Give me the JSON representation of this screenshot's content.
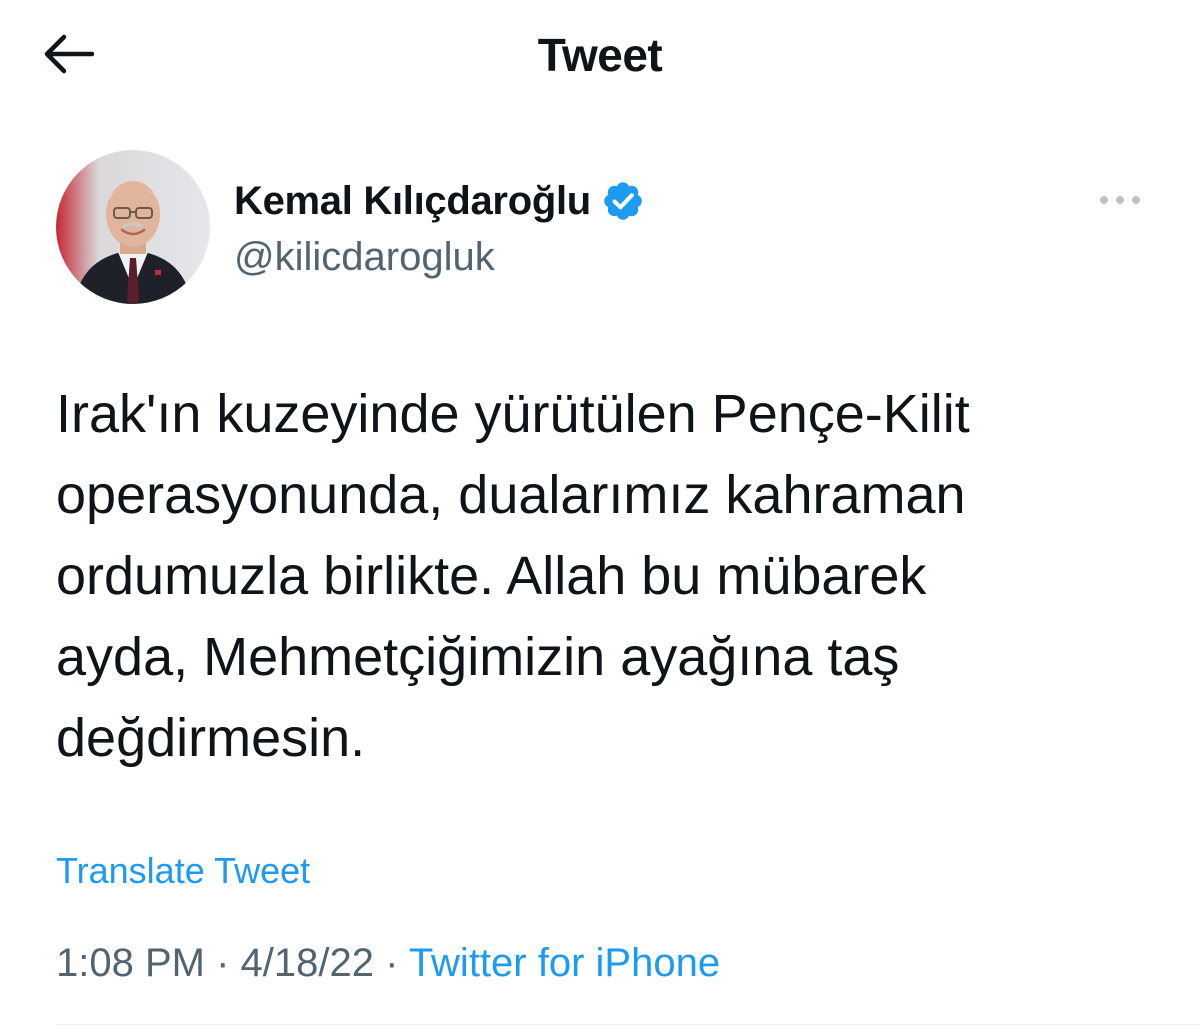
{
  "header": {
    "title": "Tweet",
    "back_icon": "arrow-left-icon"
  },
  "author": {
    "display_name": "Kemal Kılıçdaroğlu",
    "handle": "@kilicdarogluk",
    "verified": true,
    "verified_icon": "verified-badge-icon",
    "avatar_icon": "profile-photo"
  },
  "more_icon": "more-options-icon",
  "tweet": {
    "text": "Irak'ın kuzeyinde yürütülen Pençe-Kilit\noperasyonunda, dualarımız kahraman\nordumuzla birlikte. Allah bu mübarek\nayda, Mehmetçiğimizin ayağına taş\ndeğdirmesin.",
    "translate_label": "Translate Tweet",
    "time": "1:08 PM",
    "separator": " · ",
    "date": "4/18/22",
    "source": "Twitter for iPhone"
  },
  "colors": {
    "accent": "#1d9bf0",
    "text_primary": "#0f1419",
    "text_secondary": "#536471"
  }
}
